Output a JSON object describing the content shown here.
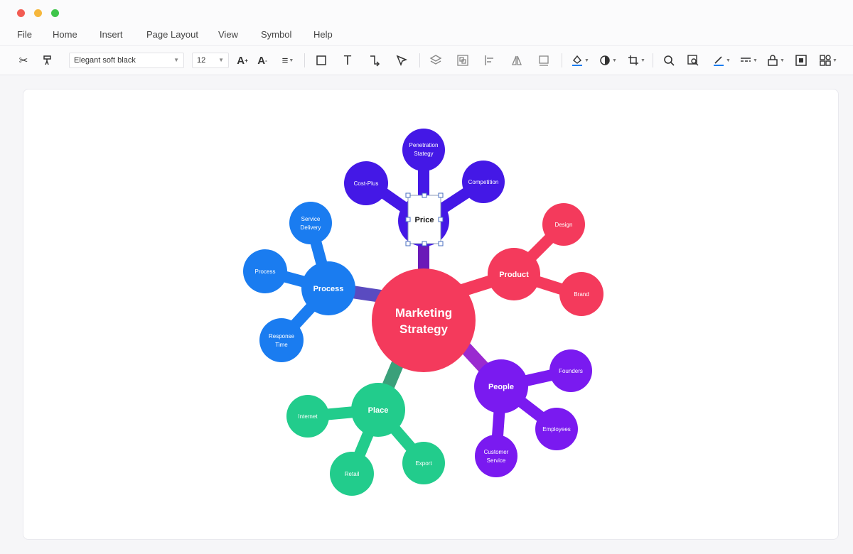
{
  "menu": {
    "file": "File",
    "home": "Home",
    "insert": "Insert",
    "page_layout": "Page Layout",
    "view": "View",
    "symbol": "Symbol",
    "help": "Help"
  },
  "toolbar": {
    "font_name": "Elegant soft black",
    "font_size": "12"
  },
  "colors": {
    "center": "#f43a5c",
    "price": "#4418e6",
    "product": "#f43a5c",
    "process": "#1a7cf0",
    "place": "#22cc8c",
    "people": "#7a1af0"
  },
  "mindmap": {
    "center": {
      "line1": "Marketing",
      "line2": "Strategy"
    },
    "price": {
      "label": "Price",
      "children": [
        {
          "line1": "Penetration",
          "line2": "Stategy"
        },
        {
          "line1": "Cost-Plus",
          "line2": ""
        },
        {
          "line1": "Competition",
          "line2": ""
        }
      ]
    },
    "product": {
      "label": "Product",
      "children": [
        {
          "line1": "Design",
          "line2": ""
        },
        {
          "line1": "Brand",
          "line2": ""
        }
      ]
    },
    "process": {
      "label": "Process",
      "children": [
        {
          "line1": "Service",
          "line2": "Delivery"
        },
        {
          "line1": "Process",
          "line2": ""
        },
        {
          "line1": "Response",
          "line2": "Time"
        }
      ]
    },
    "place": {
      "label": "Place",
      "children": [
        {
          "line1": "Internet",
          "line2": ""
        },
        {
          "line1": "Retail",
          "line2": ""
        },
        {
          "line1": "Export",
          "line2": ""
        }
      ]
    },
    "people": {
      "label": "People",
      "children": [
        {
          "line1": "Founders",
          "line2": ""
        },
        {
          "line1": "Employees",
          "line2": ""
        },
        {
          "line1": "Customer",
          "line2": "Service"
        }
      ]
    }
  }
}
